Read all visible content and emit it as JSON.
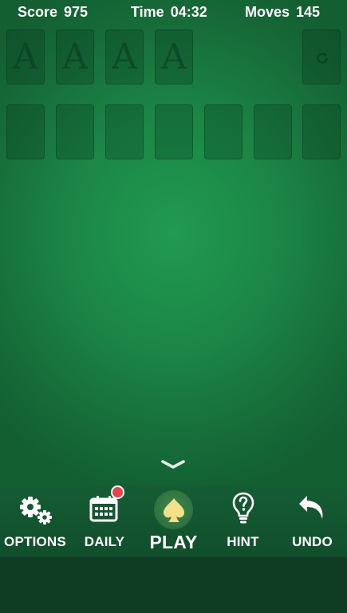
{
  "status": {
    "score_label": "Score",
    "score_value": "975",
    "time_label": "Time",
    "time_value": "04:32",
    "moves_label": "Moves",
    "moves_value": "145"
  },
  "foundations": [
    {
      "letter": "A"
    },
    {
      "letter": "A"
    },
    {
      "letter": "A"
    },
    {
      "letter": "A"
    }
  ],
  "stock": {
    "icon": "recycle-icon"
  },
  "tableau_count": 7,
  "colors": {
    "felt_center": "#219a52",
    "felt_edge": "#135f32",
    "bar": "#145c33",
    "badge": "#e8434a",
    "play_symbol": "#f5e08a"
  },
  "nav": {
    "options": {
      "label": "OPTIONS",
      "icon": "gear-icon"
    },
    "daily": {
      "label": "DAILY",
      "icon": "calendar-icon",
      "badge": true
    },
    "play": {
      "label": "PLAY",
      "icon": "spade-icon"
    },
    "hint": {
      "label": "HINT",
      "icon": "lightbulb-question-icon"
    },
    "undo": {
      "label": "UNDO",
      "icon": "undo-arrow-icon"
    }
  }
}
